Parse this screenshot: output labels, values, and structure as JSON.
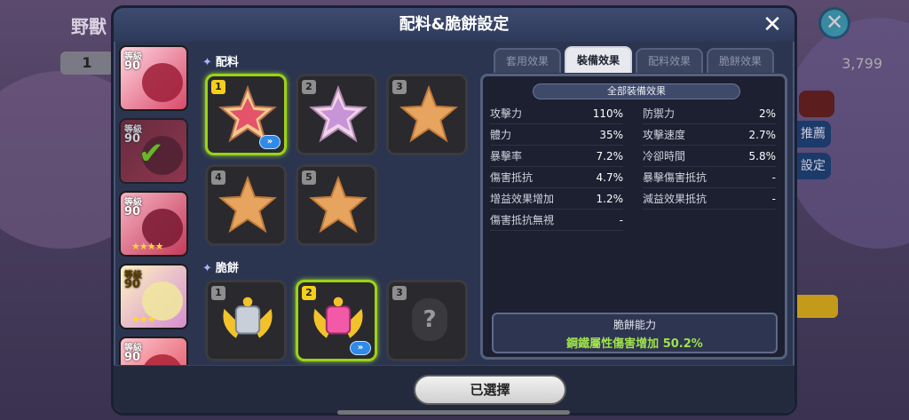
{
  "background": {
    "title": "野獸",
    "level_badge": "1",
    "currency": "3,799",
    "side_buttons": [
      "",
      "推薦",
      "設定"
    ]
  },
  "modal": {
    "title": "配料&脆餅設定",
    "close_icon": "close-icon"
  },
  "cookies": [
    {
      "level_label": "等級",
      "level": "90",
      "stars": "",
      "color": "#d94a6a",
      "checked": false
    },
    {
      "level_label": "等級",
      "level": "90",
      "stars": "",
      "color": "#b0364e",
      "checked": true
    },
    {
      "level_label": "等級",
      "level": "90",
      "stars": "★★★★",
      "color": "#c43a5a",
      "checked": false
    },
    {
      "level_label": "等級",
      "level": "90",
      "stars": "★★★",
      "color": "#d48ed0",
      "checked": false
    },
    {
      "level_label": "等級",
      "level": "90",
      "stars": "★★★",
      "color": "#e04a5a",
      "checked": false
    }
  ],
  "toppings": {
    "label": "配料",
    "slots": [
      {
        "num": "1",
        "type": "gem-pink",
        "selected": true,
        "upgrade": "»"
      },
      {
        "num": "2",
        "type": "gem-lilac",
        "selected": false,
        "upgrade": ""
      },
      {
        "num": "3",
        "type": "empty",
        "selected": false,
        "upgrade": ""
      },
      {
        "num": "4",
        "type": "empty",
        "selected": false,
        "upgrade": ""
      },
      {
        "num": "5",
        "type": "empty",
        "selected": false,
        "upgrade": ""
      }
    ]
  },
  "biscuits": {
    "label": "脆餅",
    "slots": [
      {
        "num": "1",
        "type": "crest-silver",
        "selected": false,
        "upgrade": ""
      },
      {
        "num": "2",
        "type": "crest-pink",
        "selected": true,
        "upgrade": "»"
      },
      {
        "num": "3",
        "type": "locked",
        "selected": false,
        "upgrade": "",
        "mark": "?"
      }
    ]
  },
  "tabs": [
    "套用效果",
    "裝備效果",
    "配料效果",
    "脆餅效果"
  ],
  "active_tab": 1,
  "effects": {
    "title": "全部裝備效果",
    "left": [
      {
        "k": "攻擊力",
        "v": "110%"
      },
      {
        "k": "體力",
        "v": "35%"
      },
      {
        "k": "暴擊率",
        "v": "7.2%"
      },
      {
        "k": "傷害抵抗",
        "v": "4.7%"
      },
      {
        "k": "增益效果增加",
        "v": "1.2%"
      },
      {
        "k": "傷害抵抗無視",
        "v": "-"
      }
    ],
    "right": [
      {
        "k": "防禦力",
        "v": "2%"
      },
      {
        "k": "攻擊速度",
        "v": "2.7%"
      },
      {
        "k": "冷卻時間",
        "v": "5.8%"
      },
      {
        "k": "暴擊傷害抵抗",
        "v": "-"
      },
      {
        "k": "減益效果抵抗",
        "v": "-"
      }
    ]
  },
  "ability": {
    "title": "脆餅能力",
    "body": "鋼鐵屬性傷害增加 50.2%"
  },
  "footer": {
    "select_label": "已選擇"
  },
  "colors": {
    "selected_border": "#9bd21a",
    "ability_text": "#9fe24b",
    "upgrade_badge": "#2f8ae8"
  }
}
